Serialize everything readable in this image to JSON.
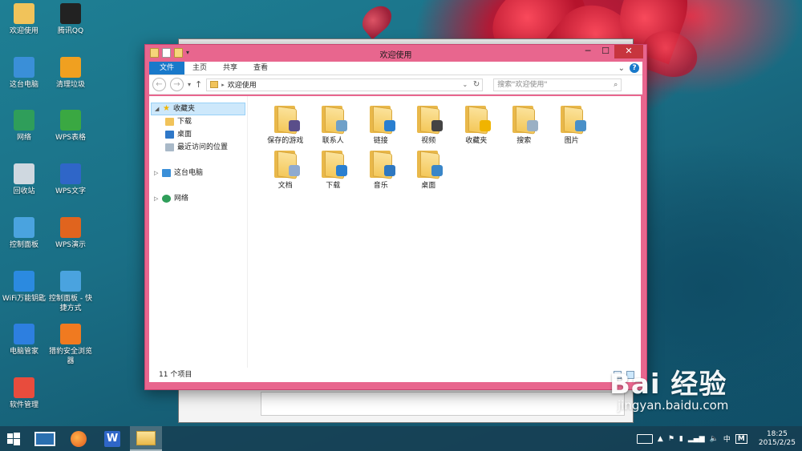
{
  "desktop": {
    "icons": [
      {
        "label": "欢迎使用",
        "icon": "folder-icon",
        "color": "#f1c35a"
      },
      {
        "label": "腾讯QQ",
        "icon": "qq-penguin-icon",
        "color": "#222222"
      },
      {
        "label": "这台电脑",
        "icon": "computer-icon",
        "color": "#3a8fd8"
      },
      {
        "label": "清理垃圾",
        "icon": "broom-icon",
        "color": "#f0a020"
      },
      {
        "label": "网络",
        "icon": "network-globe-icon",
        "color": "#2f9e5a"
      },
      {
        "label": "WPS表格",
        "icon": "wps-spreadsheet-icon",
        "color": "#3aa842"
      },
      {
        "label": "回收站",
        "icon": "recycle-bin-icon",
        "color": "#cfd8e0"
      },
      {
        "label": "WPS文字",
        "icon": "wps-writer-icon",
        "color": "#2f66c8"
      },
      {
        "label": "控制面板",
        "icon": "control-panel-icon",
        "color": "#4aa3df"
      },
      {
        "label": "WPS演示",
        "icon": "wps-presentation-icon",
        "color": "#e0641e"
      },
      {
        "label": "WiFi万能钥匙",
        "icon": "wifi-key-icon",
        "color": "#2b8ae0"
      },
      {
        "label": "控制面板 - 快捷方式",
        "icon": "control-panel-shortcut-icon",
        "color": "#4aa3df"
      },
      {
        "label": "电脑管家",
        "icon": "pc-manager-shield-icon",
        "color": "#2d7fe0"
      },
      {
        "label": "猎豹安全浏览器",
        "icon": "cheetah-browser-icon",
        "color": "#f07a20"
      },
      {
        "label": "软件管理",
        "icon": "software-manager-icon",
        "color": "#e84c3d"
      }
    ]
  },
  "window": {
    "title": "欢迎使用",
    "controls": {
      "minimize": "─",
      "maximize": "☐",
      "close": "✕"
    },
    "ribbon_tabs": [
      "文件",
      "主页",
      "共享",
      "查看"
    ],
    "address_path": "欢迎使用",
    "search_placeholder": "搜索\"欢迎使用\"",
    "nav": {
      "favorites": "收藏夹",
      "favorites_items": [
        "下载",
        "桌面",
        "最近访问的位置"
      ],
      "this_pc": "这台电脑",
      "network": "网络"
    },
    "folders": [
      {
        "label": "保存的游戏",
        "badge": "gamepad-icon",
        "color": "#5a4e8a"
      },
      {
        "label": "联系人",
        "badge": "contact-card-icon",
        "color": "#6fa0c8"
      },
      {
        "label": "链接",
        "badge": "link-arrow-icon",
        "color": "#2a7fd0"
      },
      {
        "label": "视频",
        "badge": "film-icon",
        "color": "#444444"
      },
      {
        "label": "收藏夹",
        "badge": "star-icon",
        "color": "#f0b400"
      },
      {
        "label": "搜索",
        "badge": "magnifier-icon",
        "color": "#9ab0c4"
      },
      {
        "label": "图片",
        "badge": "picture-icon",
        "color": "#4a90c8"
      },
      {
        "label": "文档",
        "badge": "document-icon",
        "color": "#8faad0"
      },
      {
        "label": "下载",
        "badge": "download-arrow-icon",
        "color": "#2a7fd0"
      },
      {
        "label": "音乐",
        "badge": "music-note-icon",
        "color": "#2f78c0"
      },
      {
        "label": "桌面",
        "badge": "desktop-screen-icon",
        "color": "#3a86c8"
      }
    ],
    "status": "11 个项目"
  },
  "taskbar": {
    "apps": [
      "start-button",
      "lenovo-monitor-app",
      "cheetah-browser-app",
      "wps-writer-app",
      "file-explorer-app"
    ],
    "ime": "中",
    "time": "18:25",
    "date": "2015/2/25"
  },
  "watermark": {
    "brand": "Bai  经验",
    "url": "jingyan.baidu.com"
  }
}
